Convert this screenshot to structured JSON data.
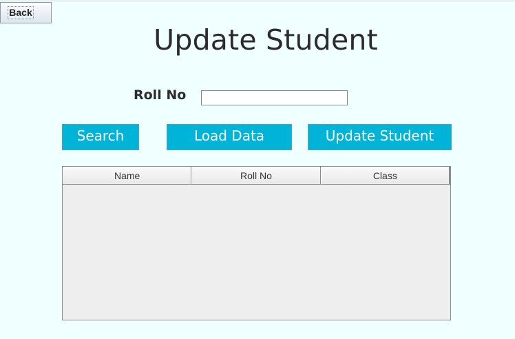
{
  "header": {
    "back_label": "Back",
    "title": "Update Student"
  },
  "form": {
    "roll_label": "Roll No",
    "roll_value": "",
    "roll_placeholder": ""
  },
  "actions": {
    "search_label": "Search",
    "load_label": "Load Data",
    "update_label": "Update Student"
  },
  "table": {
    "columns": [
      "Name",
      "Roll No",
      "Class"
    ],
    "rows": []
  },
  "colors": {
    "background": "#f0ffff",
    "button_accent": "#00b4d8",
    "table_fill": "#eeeeee"
  }
}
